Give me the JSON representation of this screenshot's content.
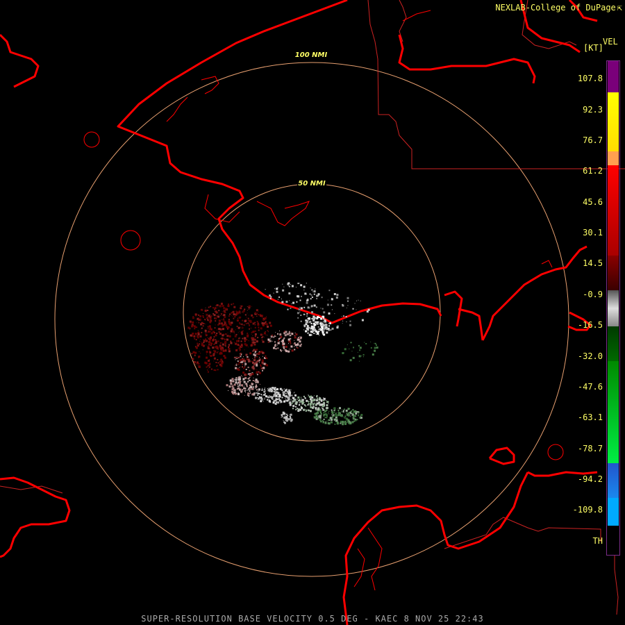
{
  "credit": {
    "text": "NEXLAB-College of DuPage",
    "flag": "⇱"
  },
  "legend": {
    "title": "VEL",
    "unit": "[KT]",
    "ticks": [
      "107.8",
      "92.3",
      "76.7",
      "61.2",
      "45.6",
      "30.1",
      "14.5",
      "-0.9",
      "-16.5",
      "-32.0",
      "-47.6",
      "-63.1",
      "-78.7",
      "-94.2",
      "-109.8",
      "TH"
    ],
    "colors": {
      "purple": "#7a007a",
      "yellow": "#ffff00",
      "orange": "#ffa050",
      "red": "#ff0000",
      "darkred": "#6a0000",
      "gray": "#bbbbbb",
      "darkgreen": "#006000",
      "green": "#00ee44",
      "blue": "#2266dd",
      "cyan": "#00aaff",
      "th": "#000000"
    }
  },
  "rings": [
    {
      "label": "100 NMI"
    },
    {
      "label": "50 NMI"
    }
  ],
  "radar": {
    "site": "KAEC"
  },
  "map_colors": {
    "coast": "#ff0000",
    "ring": "#e8a070",
    "boundary": "#cc2222"
  },
  "footer": {
    "text": "SUPER-RESOLUTION BASE VELOCITY 0.5 DEG - KAEC 8 NOV 25 22:43"
  }
}
